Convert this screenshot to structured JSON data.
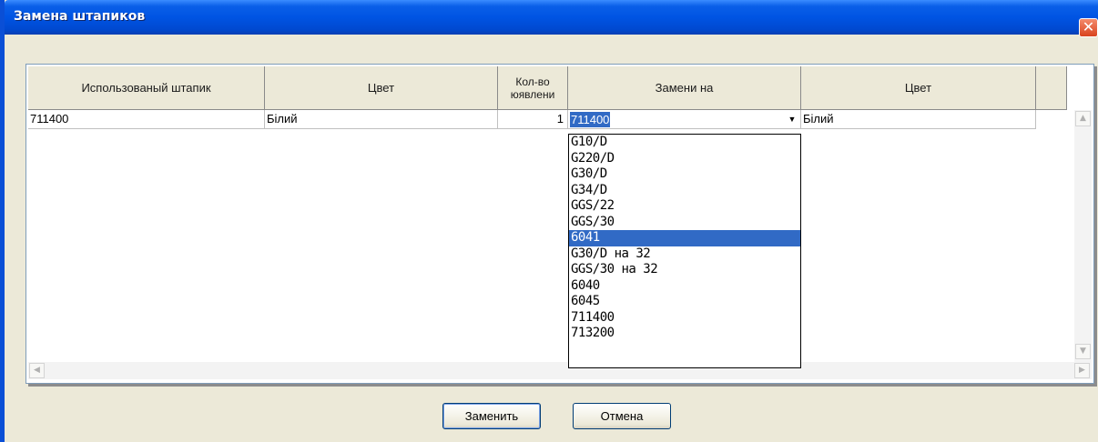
{
  "window": {
    "title": "Замена штапиков",
    "close_glyph": "✕"
  },
  "table": {
    "headers": [
      "Использованый штапик",
      "Цвет",
      "Кол-во\nюявлени",
      "Замени на",
      "Цвет"
    ],
    "rows": [
      {
        "used": "711400",
        "color": "Білий",
        "count": "1",
        "replace": "711400",
        "new_color": "Білий"
      }
    ]
  },
  "dropdown": {
    "items": [
      "G10/D",
      "G220/D",
      "G30/D",
      "G34/D",
      "GGS/22",
      "GGS/30",
      "6041",
      "G30/D на 32",
      "GGS/30 на 32",
      "6040",
      "6045",
      "711400",
      "713200"
    ],
    "highlighted": "6041"
  },
  "buttons": {
    "replace": "Заменить",
    "cancel": "Отмена"
  },
  "icons": {
    "combo_arrow": "chevron-down-icon",
    "scroll_up": "arrow-up-icon",
    "scroll_down": "arrow-down-icon",
    "scroll_left": "arrow-left-icon",
    "scroll_right": "arrow-right-icon"
  },
  "colors": {
    "titlebar": "#0054e3",
    "selection": "#316ac5",
    "dialog_bg": "#ece9d8"
  }
}
